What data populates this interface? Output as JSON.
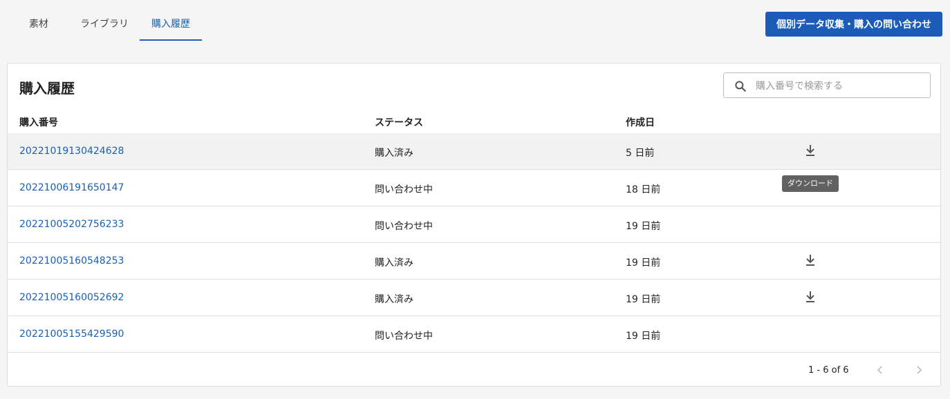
{
  "nav": {
    "tabs": [
      {
        "label": "素材"
      },
      {
        "label": "ライブラリ"
      },
      {
        "label": "購入履歴"
      }
    ],
    "contact_button": "個別データ収集・購入の問い合わせ"
  },
  "card": {
    "title": "購入履歴",
    "search_placeholder": "購入番号で検索する",
    "columns": {
      "order_no": "購入番号",
      "status": "ステータス",
      "created": "作成日"
    },
    "rows": [
      {
        "order_no": "20221019130424628",
        "status": "購入済み",
        "created": "5 日前",
        "downloadable": true
      },
      {
        "order_no": "20221006191650147",
        "status": "問い合わせ中",
        "created": "18 日前",
        "downloadable": false
      },
      {
        "order_no": "20221005202756233",
        "status": "問い合わせ中",
        "created": "19 日前",
        "downloadable": false
      },
      {
        "order_no": "20221005160548253",
        "status": "購入済み",
        "created": "19 日前",
        "downloadable": true
      },
      {
        "order_no": "20221005160052692",
        "status": "購入済み",
        "created": "19 日前",
        "downloadable": true
      },
      {
        "order_no": "20221005155429590",
        "status": "問い合わせ中",
        "created": "19 日前",
        "downloadable": false
      }
    ],
    "tooltip": "ダウンロード",
    "pagination": {
      "range": "1 - 6 of 6"
    }
  },
  "colors": {
    "accent": "#1a5fb4",
    "button": "#1a5cb8",
    "tooltip": "#616161"
  },
  "icons": [
    "search-icon",
    "download-icon",
    "chevron-left-icon",
    "chevron-right-icon"
  ]
}
